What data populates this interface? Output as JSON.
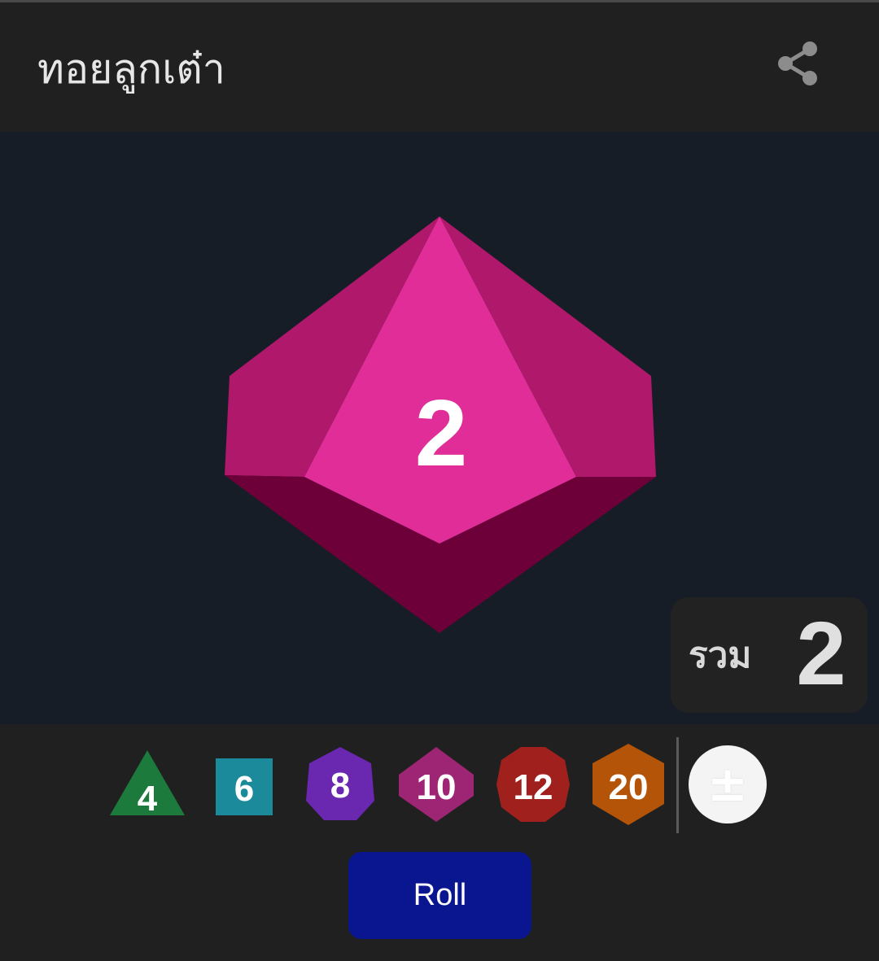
{
  "app": {
    "title": "ทอยลูกเต๋า",
    "share_icon": "share-icon"
  },
  "result": {
    "die_type": "d10",
    "die_color": "#e02d98",
    "die_value": "2",
    "total_label": "รวม",
    "total_value": "2"
  },
  "dice_selector": [
    {
      "label": "4",
      "shape": "triangle",
      "color": "#1b7a3c"
    },
    {
      "label": "6",
      "shape": "square",
      "color": "#1b8a9a"
    },
    {
      "label": "8",
      "shape": "octagon-hex",
      "color": "#6a27b0"
    },
    {
      "label": "10",
      "shape": "diamond-hex",
      "color": "#9e2474"
    },
    {
      "label": "12",
      "shape": "decagon",
      "color": "#a0201e"
    },
    {
      "label": "20",
      "shape": "hexagon",
      "color": "#b35408"
    }
  ],
  "modifier": {
    "label": "±",
    "icon": "plus-minus-icon"
  },
  "roll_button": {
    "label": "Roll",
    "color": "#0a1690"
  }
}
